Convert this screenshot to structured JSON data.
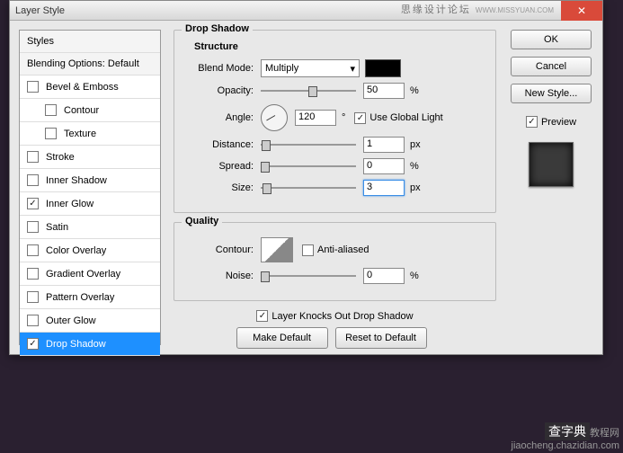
{
  "window": {
    "title": "Layer Style",
    "watermark": "思缘设计论坛",
    "watermark2": "WWW.MISSYUAN.COM"
  },
  "sidebar": {
    "header1": "Styles",
    "header2": "Blending Options: Default",
    "items": [
      {
        "label": "Bevel & Emboss",
        "checked": false
      },
      {
        "label": "Contour",
        "checked": false,
        "sub": true
      },
      {
        "label": "Texture",
        "checked": false,
        "sub": true
      },
      {
        "label": "Stroke",
        "checked": false
      },
      {
        "label": "Inner Shadow",
        "checked": false
      },
      {
        "label": "Inner Glow",
        "checked": true
      },
      {
        "label": "Satin",
        "checked": false
      },
      {
        "label": "Color Overlay",
        "checked": false
      },
      {
        "label": "Gradient Overlay",
        "checked": false
      },
      {
        "label": "Pattern Overlay",
        "checked": false
      },
      {
        "label": "Outer Glow",
        "checked": false
      },
      {
        "label": "Drop Shadow",
        "checked": true,
        "selected": true
      }
    ]
  },
  "panel": {
    "title": "Drop Shadow",
    "structure": {
      "title": "Structure",
      "blend_mode_label": "Blend Mode:",
      "blend_mode_value": "Multiply",
      "opacity_label": "Opacity:",
      "opacity_value": "50",
      "opacity_unit": "%",
      "angle_label": "Angle:",
      "angle_value": "120",
      "angle_unit": "°",
      "global_light_label": "Use Global Light",
      "distance_label": "Distance:",
      "distance_value": "1",
      "distance_unit": "px",
      "spread_label": "Spread:",
      "spread_value": "0",
      "spread_unit": "%",
      "size_label": "Size:",
      "size_value": "3",
      "size_unit": "px"
    },
    "quality": {
      "title": "Quality",
      "contour_label": "Contour:",
      "antialiased_label": "Anti-aliased",
      "noise_label": "Noise:",
      "noise_value": "0",
      "noise_unit": "%"
    },
    "knockout_label": "Layer Knocks Out Drop Shadow",
    "make_default": "Make Default",
    "reset_default": "Reset to Default"
  },
  "buttons": {
    "ok": "OK",
    "cancel": "Cancel",
    "new_style": "New Style...",
    "preview": "Preview"
  },
  "footer": {
    "big": "查字典",
    "small": "教程网",
    "url": "jiaocheng.chazidian.com"
  }
}
